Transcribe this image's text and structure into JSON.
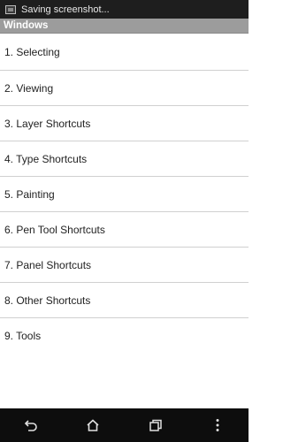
{
  "status_bar": {
    "notification_text": "Saving screenshot...",
    "icon": "screenshot-icon"
  },
  "title_bar": {
    "title": "Windows"
  },
  "menu": {
    "items": [
      {
        "label": "1. Selecting"
      },
      {
        "label": "2. Viewing"
      },
      {
        "label": "3. Layer Shortcuts"
      },
      {
        "label": "4. Type Shortcuts"
      },
      {
        "label": "5. Painting"
      },
      {
        "label": "6. Pen Tool Shortcuts"
      },
      {
        "label": "7. Panel Shortcuts"
      },
      {
        "label": "8. Other Shortcuts"
      },
      {
        "label": "9. Tools"
      }
    ]
  },
  "nav_bar": {
    "buttons": [
      "back-icon",
      "home-icon",
      "recents-icon",
      "overflow-menu-icon"
    ]
  },
  "colors": {
    "title_bar_bg": "#9c9c9c",
    "status_bar_bg": "#1e1e1e",
    "nav_bar_bg": "#0d0d0d",
    "divider": "#d0d0d0"
  }
}
